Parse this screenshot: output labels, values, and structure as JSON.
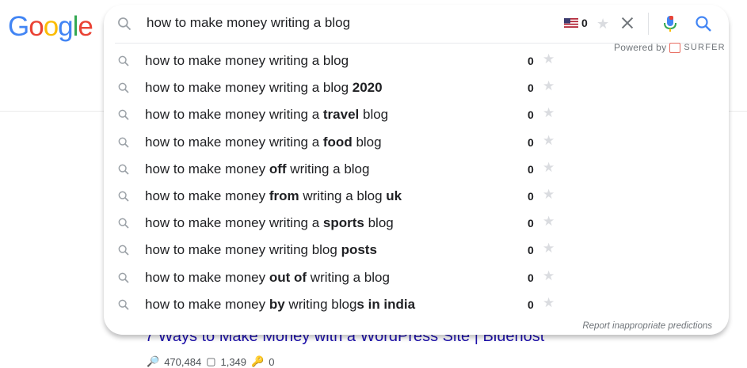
{
  "logo": {
    "letters": [
      {
        "ch": "G",
        "color": "#4285F4"
      },
      {
        "ch": "o",
        "color": "#EA4335"
      },
      {
        "ch": "o",
        "color": "#FBBC05"
      },
      {
        "ch": "g",
        "color": "#4285F4"
      },
      {
        "ch": "l",
        "color": "#34A853"
      },
      {
        "ch": "e",
        "color": "#EA4335"
      }
    ]
  },
  "search": {
    "value": "how to make money writing a blog",
    "flag_count": "0",
    "powered_by": "Powered by",
    "surfer": "SURFER"
  },
  "suggestions": [
    {
      "parts": [
        {
          "t": "how to make money writing a blog",
          "b": false
        }
      ],
      "count": "0"
    },
    {
      "parts": [
        {
          "t": "how to make money writing a blog ",
          "b": false
        },
        {
          "t": "2020",
          "b": true
        }
      ],
      "count": "0"
    },
    {
      "parts": [
        {
          "t": "how to make money writing a ",
          "b": false
        },
        {
          "t": "travel",
          "b": true
        },
        {
          "t": " blog",
          "b": false
        }
      ],
      "count": "0"
    },
    {
      "parts": [
        {
          "t": "how to make money writing a ",
          "b": false
        },
        {
          "t": "food",
          "b": true
        },
        {
          "t": " blog",
          "b": false
        }
      ],
      "count": "0"
    },
    {
      "parts": [
        {
          "t": "how to make money ",
          "b": false
        },
        {
          "t": "off",
          "b": true
        },
        {
          "t": " writing a blog",
          "b": false
        }
      ],
      "count": "0"
    },
    {
      "parts": [
        {
          "t": "how to make money ",
          "b": false
        },
        {
          "t": "from",
          "b": true
        },
        {
          "t": " writing a blog ",
          "b": false
        },
        {
          "t": "uk",
          "b": true
        }
      ],
      "count": "0"
    },
    {
      "parts": [
        {
          "t": "how to make money writing a ",
          "b": false
        },
        {
          "t": "sports",
          "b": true
        },
        {
          "t": " blog",
          "b": false
        }
      ],
      "count": "0"
    },
    {
      "parts": [
        {
          "t": "how to make money writing blog ",
          "b": false
        },
        {
          "t": "posts",
          "b": true
        }
      ],
      "count": "0"
    },
    {
      "parts": [
        {
          "t": "how to make money ",
          "b": false
        },
        {
          "t": "out of",
          "b": true
        },
        {
          "t": " writing a blog",
          "b": false
        }
      ],
      "count": "0"
    },
    {
      "parts": [
        {
          "t": "how to make money ",
          "b": false
        },
        {
          "t": "by",
          "b": true
        },
        {
          "t": " writing blog",
          "b": false
        },
        {
          "t": "s in india",
          "b": true
        }
      ],
      "count": "0"
    }
  ],
  "report_link": "Report inappropriate predictions",
  "background_result": {
    "title": "7 Ways to Make Money with a WordPress Site | Bluehost",
    "stats": [
      "470,484",
      "1,349",
      "0"
    ]
  }
}
